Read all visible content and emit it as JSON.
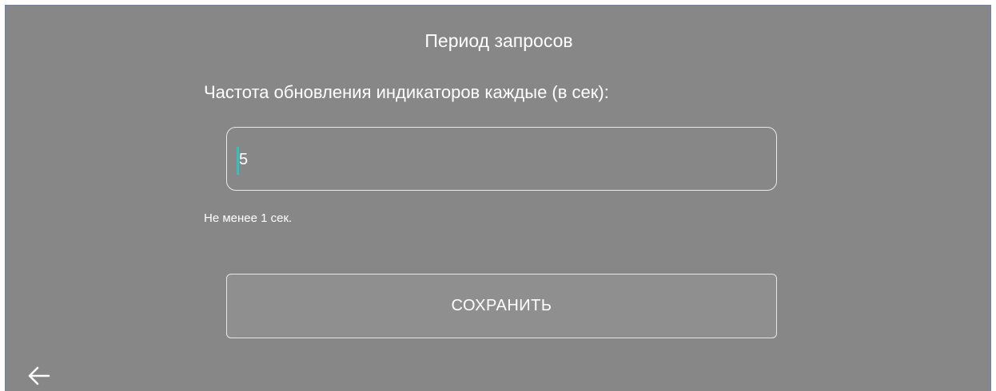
{
  "screen": {
    "title": "Период запросов",
    "field_label": "Частота обновления индикаторов каждые (в сек):",
    "input": {
      "value": "5",
      "placeholder": ""
    },
    "hint": "Не менее 1 сек.",
    "save_label": "СОХРАНИТЬ"
  },
  "nav": {
    "back_icon": "arrow-left-icon"
  },
  "colors": {
    "background": "#878787",
    "text": "#ffffff",
    "cursor_accent": "#2fc3bd",
    "border": "#e9e9e9"
  }
}
